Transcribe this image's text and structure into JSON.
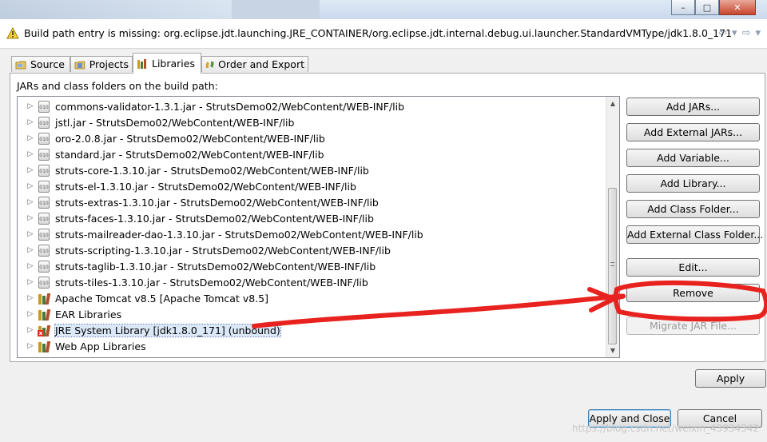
{
  "window": {
    "minimize": "–",
    "maximize": "□",
    "close": "✕"
  },
  "message": {
    "icon": "warning-icon",
    "text": "Build path entry is missing: org.eclipse.jdt.launching.JRE_CONTAINER/org.eclipse.jdt.internal.debug.ui.launcher.StandardVMType/jdk1.8.0_171",
    "back": "⇦",
    "back_menu": "▾",
    "forward": "⇨",
    "forward_menu": "▾"
  },
  "tabs": [
    {
      "label": "Source",
      "icon": "source-folder-icon"
    },
    {
      "label": "Projects",
      "icon": "projects-icon"
    },
    {
      "label": "Libraries",
      "icon": "libraries-icon",
      "active": true
    },
    {
      "label": "Order and Export",
      "icon": "order-export-icon"
    }
  ],
  "panel_label": "JARs and class folders on the build path:",
  "tree_items": [
    {
      "label": "commons-validator-1.3.1.jar - StrutsDemo02/WebContent/WEB-INF/lib",
      "icon": "jar-icon"
    },
    {
      "label": "jstl.jar - StrutsDemo02/WebContent/WEB-INF/lib",
      "icon": "jar-icon"
    },
    {
      "label": "oro-2.0.8.jar - StrutsDemo02/WebContent/WEB-INF/lib",
      "icon": "jar-icon"
    },
    {
      "label": "standard.jar - StrutsDemo02/WebContent/WEB-INF/lib",
      "icon": "jar-icon"
    },
    {
      "label": "struts-core-1.3.10.jar - StrutsDemo02/WebContent/WEB-INF/lib",
      "icon": "jar-icon"
    },
    {
      "label": "struts-el-1.3.10.jar - StrutsDemo02/WebContent/WEB-INF/lib",
      "icon": "jar-icon"
    },
    {
      "label": "struts-extras-1.3.10.jar - StrutsDemo02/WebContent/WEB-INF/lib",
      "icon": "jar-icon"
    },
    {
      "label": "struts-faces-1.3.10.jar - StrutsDemo02/WebContent/WEB-INF/lib",
      "icon": "jar-icon"
    },
    {
      "label": "struts-mailreader-dao-1.3.10.jar - StrutsDemo02/WebContent/WEB-INF/lib",
      "icon": "jar-icon"
    },
    {
      "label": "struts-scripting-1.3.10.jar - StrutsDemo02/WebContent/WEB-INF/lib",
      "icon": "jar-icon"
    },
    {
      "label": "struts-taglib-1.3.10.jar - StrutsDemo02/WebContent/WEB-INF/lib",
      "icon": "jar-icon"
    },
    {
      "label": "struts-tiles-1.3.10.jar - StrutsDemo02/WebContent/WEB-INF/lib",
      "icon": "jar-icon"
    },
    {
      "label": "Apache Tomcat v8.5 [Apache Tomcat v8.5]",
      "icon": "library-icon"
    },
    {
      "label": "EAR Libraries",
      "icon": "library-icon"
    },
    {
      "label": "JRE System Library [jdk1.8.0_171] (unbound)",
      "icon": "library-error-icon",
      "selected": true
    },
    {
      "label": "Web App Libraries",
      "icon": "library-icon"
    }
  ],
  "scroll": {
    "up": "▲",
    "down": "▼"
  },
  "side_buttons": {
    "add_jars": "Add JARs...",
    "add_external_jars": "Add External JARs...",
    "add_variable": "Add Variable...",
    "add_library": "Add Library...",
    "add_class_folder": "Add Class Folder...",
    "add_external_class_folder": "Add External Class Folder...",
    "edit": "Edit...",
    "remove": "Remove",
    "migrate_jar": "Migrate JAR File..."
  },
  "footer": {
    "apply": "Apply",
    "apply_and_close": "Apply and Close",
    "cancel": "Cancel"
  },
  "watermark": "https://blog.csdn.net/weixin_43934342",
  "annotation_color": "#e8231f"
}
